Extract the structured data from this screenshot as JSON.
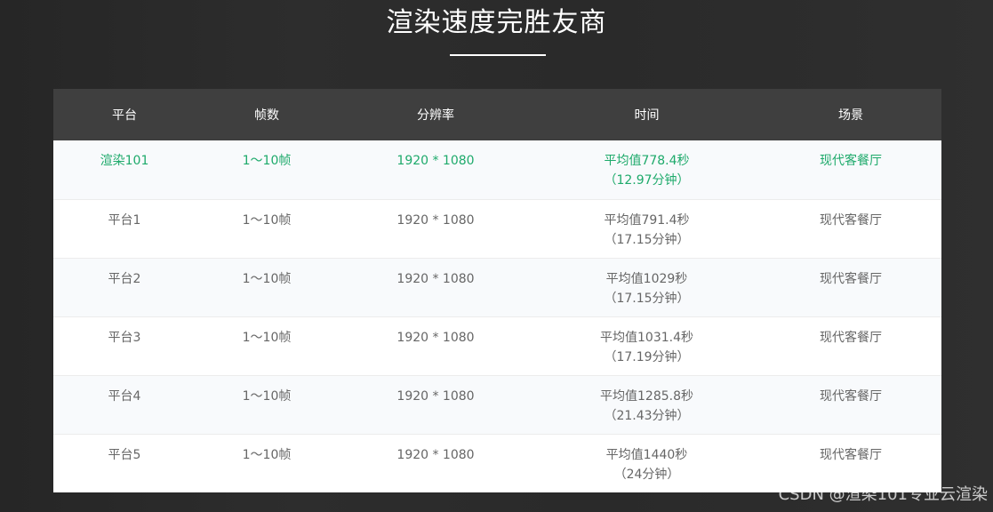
{
  "header": {
    "title": "渲染速度完胜友商"
  },
  "table": {
    "columns": [
      "平台",
      "帧数",
      "分辨率",
      "时间",
      "场景"
    ],
    "rows": [
      {
        "platform": "渲染101",
        "frames": "1～10帧",
        "resolution": "1920 * 1080",
        "time_line1": "平均值778.4秒",
        "time_line2": "（12.97分钟）",
        "scene": "现代客餐厅",
        "highlight": true
      },
      {
        "platform": "平台1",
        "frames": "1～10帧",
        "resolution": "1920 * 1080",
        "time_line1": "平均值791.4秒",
        "time_line2": "（17.15分钟）",
        "scene": "现代客餐厅",
        "highlight": false
      },
      {
        "platform": "平台2",
        "frames": "1～10帧",
        "resolution": "1920 * 1080",
        "time_line1": "平均值1029秒",
        "time_line2": "（17.15分钟）",
        "scene": "现代客餐厅",
        "highlight": false
      },
      {
        "platform": "平台3",
        "frames": "1～10帧",
        "resolution": "1920 * 1080",
        "time_line1": "平均值1031.4秒",
        "time_line2": "（17.19分钟）",
        "scene": "现代客餐厅",
        "highlight": false
      },
      {
        "platform": "平台4",
        "frames": "1～10帧",
        "resolution": "1920 * 1080",
        "time_line1": "平均值1285.8秒",
        "time_line2": "（21.43分钟）",
        "scene": "现代客餐厅",
        "highlight": false
      },
      {
        "platform": "平台5",
        "frames": "1～10帧",
        "resolution": "1920 * 1080",
        "time_line1": "平均值1440秒",
        "time_line2": "（24分钟）",
        "scene": "现代客餐厅",
        "highlight": false
      }
    ]
  },
  "colors": {
    "highlight": "#1eaa6b",
    "header_bg": "#3f3f3f",
    "page_bg": "#2b2b2b"
  },
  "watermark": "CSDN @渲染101专业云渲染"
}
